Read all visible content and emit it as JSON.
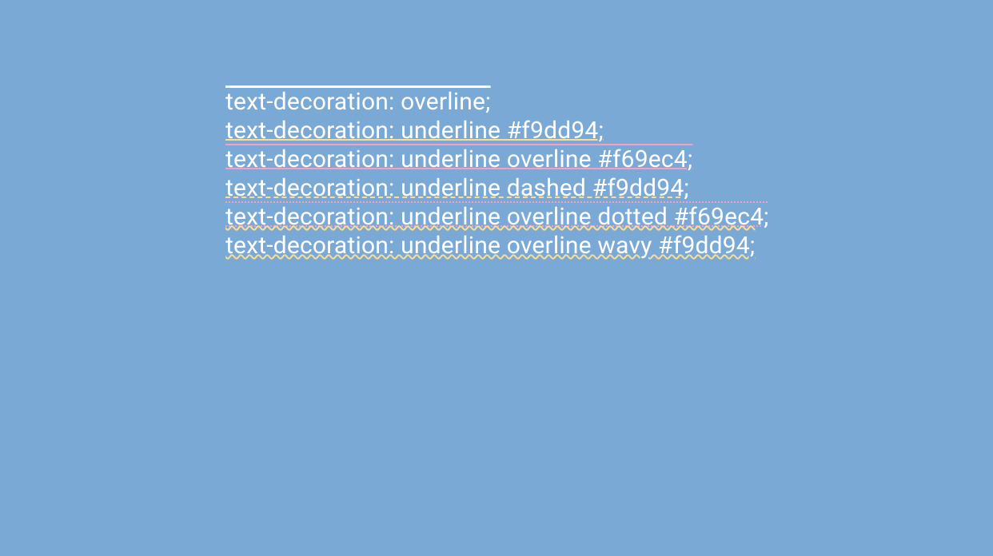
{
  "examples": [
    {
      "text": "text-decoration: overline;",
      "decoration_lines": "overline",
      "decoration_style": "solid",
      "decoration_color": null
    },
    {
      "text": "text-decoration: underline #f9dd94;",
      "decoration_lines": "underline",
      "decoration_style": "solid",
      "decoration_color": "#f9dd94"
    },
    {
      "text": "text-decoration: underline overline #f69ec4;",
      "decoration_lines": "underline overline",
      "decoration_style": "solid",
      "decoration_color": "#f69ec4"
    },
    {
      "text": "text-decoration: underline dashed #f9dd94;",
      "decoration_lines": "underline",
      "decoration_style": "dashed",
      "decoration_color": "#f9dd94"
    },
    {
      "text": "text-decoration: underline overline dotted #f69ec4;",
      "decoration_lines": "underline overline",
      "decoration_style": "dotted",
      "decoration_color": "#f69ec4"
    },
    {
      "text": "text-decoration: underline overline wavy #f9dd94;",
      "decoration_lines": "underline overline",
      "decoration_style": "wavy",
      "decoration_color": "#f9dd94"
    }
  ],
  "colors": {
    "background": "#7ba9d6",
    "text": "#ffffff",
    "yellow": "#f9dd94",
    "pink": "#f69ec4"
  }
}
